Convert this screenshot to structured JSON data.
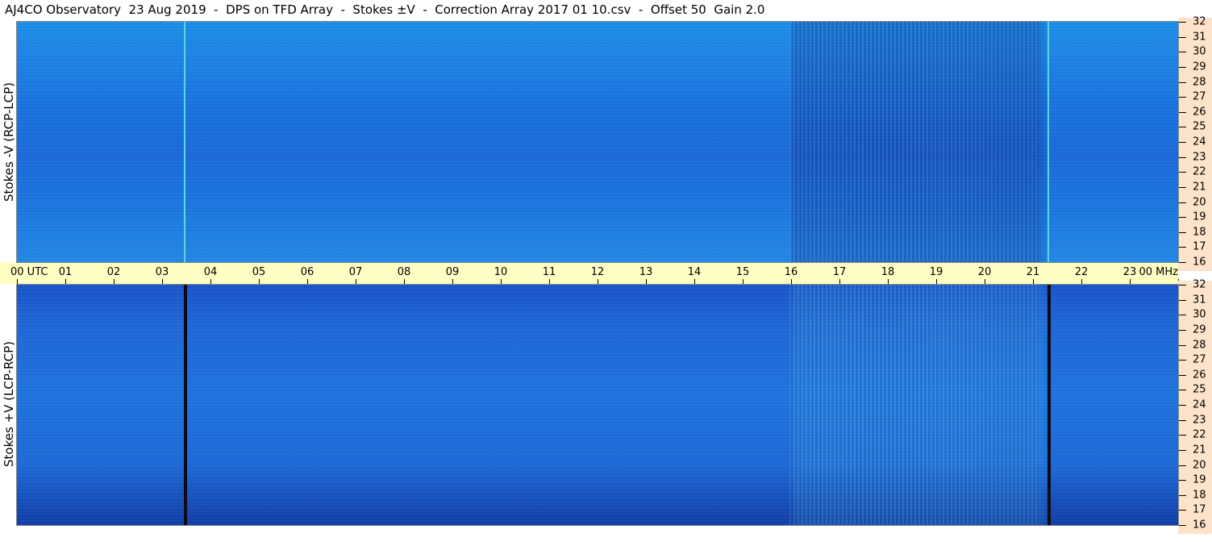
{
  "header": {
    "title": "AJ4CO Observatory  23 Aug 2019  -  DPS on TFD Array  -  Stokes ±V  -  Correction Array 2017 01 10.csv  -  Offset 50  Gain 2.0"
  },
  "chart_data": {
    "type": "heatmap",
    "panels": [
      {
        "ylabel": "Stokes -V (RCP-LCP)",
        "yticks": [
          16,
          17,
          18,
          19,
          20,
          21,
          22,
          23,
          24,
          25,
          26,
          27,
          28,
          29,
          30,
          31,
          32
        ],
        "ylim": [
          16,
          32
        ],
        "vertical_lines": [
          {
            "x": 3.45,
            "color": "#5ad8e8"
          },
          {
            "x": 21.3,
            "color": "#5ad8e8"
          }
        ]
      },
      {
        "ylabel": "Stokes +V (LCP-RCP)",
        "yticks": [
          16,
          17,
          18,
          19,
          20,
          21,
          22,
          23,
          24,
          25,
          26,
          27,
          28,
          29,
          30,
          31,
          32
        ],
        "ylim": [
          16,
          32
        ],
        "vertical_lines": [
          {
            "x": 3.45,
            "color": "#0a0a14"
          },
          {
            "x": 21.3,
            "color": "#0a0a14"
          }
        ]
      }
    ],
    "xticks": [
      "00  UTC",
      "01",
      "02",
      "03",
      "04",
      "05",
      "06",
      "07",
      "08",
      "09",
      "10",
      "11",
      "12",
      "13",
      "14",
      "15",
      "16",
      "17",
      "18",
      "19",
      "20",
      "21",
      "22",
      "23",
      "00 MHz"
    ],
    "xlim": [
      0,
      24
    ]
  }
}
